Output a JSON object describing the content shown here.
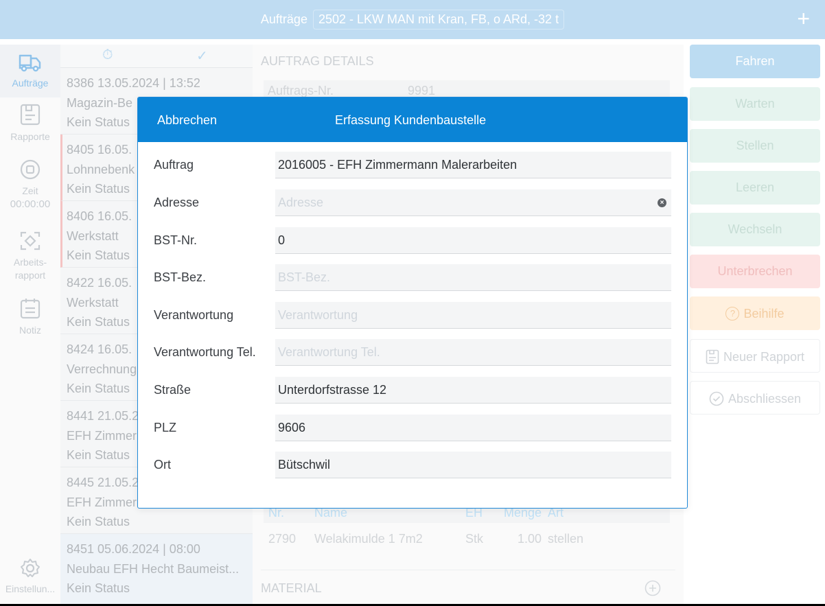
{
  "topbar": {
    "title": "Aufträge",
    "vehicle": "2502 - LKW MAN mit Kran, FB, o ARd, -32 t"
  },
  "nav": {
    "orders": "Aufträge",
    "reports": "Rapporte",
    "time_label": "Zeit",
    "time_value": "00:00:00",
    "work_report_1": "Arbeits-",
    "work_report_2": "rapport",
    "note": "Notiz",
    "settings": "Einstellun..."
  },
  "orders": [
    {
      "line1": "8386  13.05.2024 | 13:52",
      "line2": "Magazin-Be",
      "line3": "Kein Status"
    },
    {
      "line1": "8405  16.05.",
      "line2": "Lohnnebenk",
      "line3": "Kein Status"
    },
    {
      "line1": "8406  16.05.",
      "line2": "Werkstatt",
      "line3": "Kein Status"
    },
    {
      "line1": "8422  16.05.",
      "line2": "Werkstatt",
      "line3": "Kein Status"
    },
    {
      "line1": "8424  16.05.",
      "line2": "Verrechnung",
      "line3": "Kein Status"
    },
    {
      "line1": "8441  21.05.2",
      "line2": "EFH Zimmer",
      "line3": "Kein Status"
    },
    {
      "line1": "8445  21.05.2",
      "line2": "EFH Zimmer",
      "line3": "Kein Status"
    },
    {
      "line1": "8451  05.06.2024 | 08:00",
      "line2": "Neubau EFH Hecht Baumeist...",
      "line3": "Kein Status"
    }
  ],
  "details": {
    "section_title": "AUFTRAG DETAILS",
    "order_no_label": "Auftrags-Nr.",
    "order_no_value": "9991",
    "table_headers": {
      "nr": "Nr.",
      "name": "Name",
      "eh": "EH",
      "menge": "Menge",
      "art": "Art"
    },
    "table_row": {
      "nr": "2790",
      "name": "Welakimulde 1 7m2",
      "eh": "Stk",
      "menge": "1.00",
      "art": "stellen"
    },
    "material_title": "MATERIAL"
  },
  "actions": {
    "drive": "Fahren",
    "wait": "Warten",
    "place": "Stellen",
    "empty": "Leeren",
    "change": "Wechseln",
    "interrupt": "Unterbrechen",
    "assist": "Beihilfe",
    "new_report": "Neuer Rapport",
    "complete": "Abschliessen"
  },
  "modal": {
    "cancel": "Abbrechen",
    "title": "Erfassung Kundenbaustelle",
    "fields": [
      {
        "label": "Auftrag",
        "value": "2016005 - EFH Zimmermann Malerarbeiten",
        "placeholder": ""
      },
      {
        "label": "Adresse",
        "value": "",
        "placeholder": "Adresse"
      },
      {
        "label": "BST-Nr.",
        "value": "0",
        "placeholder": ""
      },
      {
        "label": "BST-Bez.",
        "value": "",
        "placeholder": "BST-Bez."
      },
      {
        "label": "Verantwortung",
        "value": "",
        "placeholder": "Verantwortung"
      },
      {
        "label": "Verantwortung Tel.",
        "value": "",
        "placeholder": "Verantwortung Tel."
      },
      {
        "label": "Straße",
        "value": "Unterdorfstrasse 12",
        "placeholder": ""
      },
      {
        "label": "PLZ",
        "value": "9606",
        "placeholder": ""
      },
      {
        "label": "Ort",
        "value": "Bütschwil",
        "placeholder": ""
      }
    ]
  },
  "colors": {
    "topbar": "#bfdcf2",
    "modal_header": "#0b84d6",
    "drive_button": "#bcdcf2",
    "status_buttons": "#e6f4ef",
    "interrupt_button": "#fde3e3",
    "assist_button": "#fff0de"
  }
}
